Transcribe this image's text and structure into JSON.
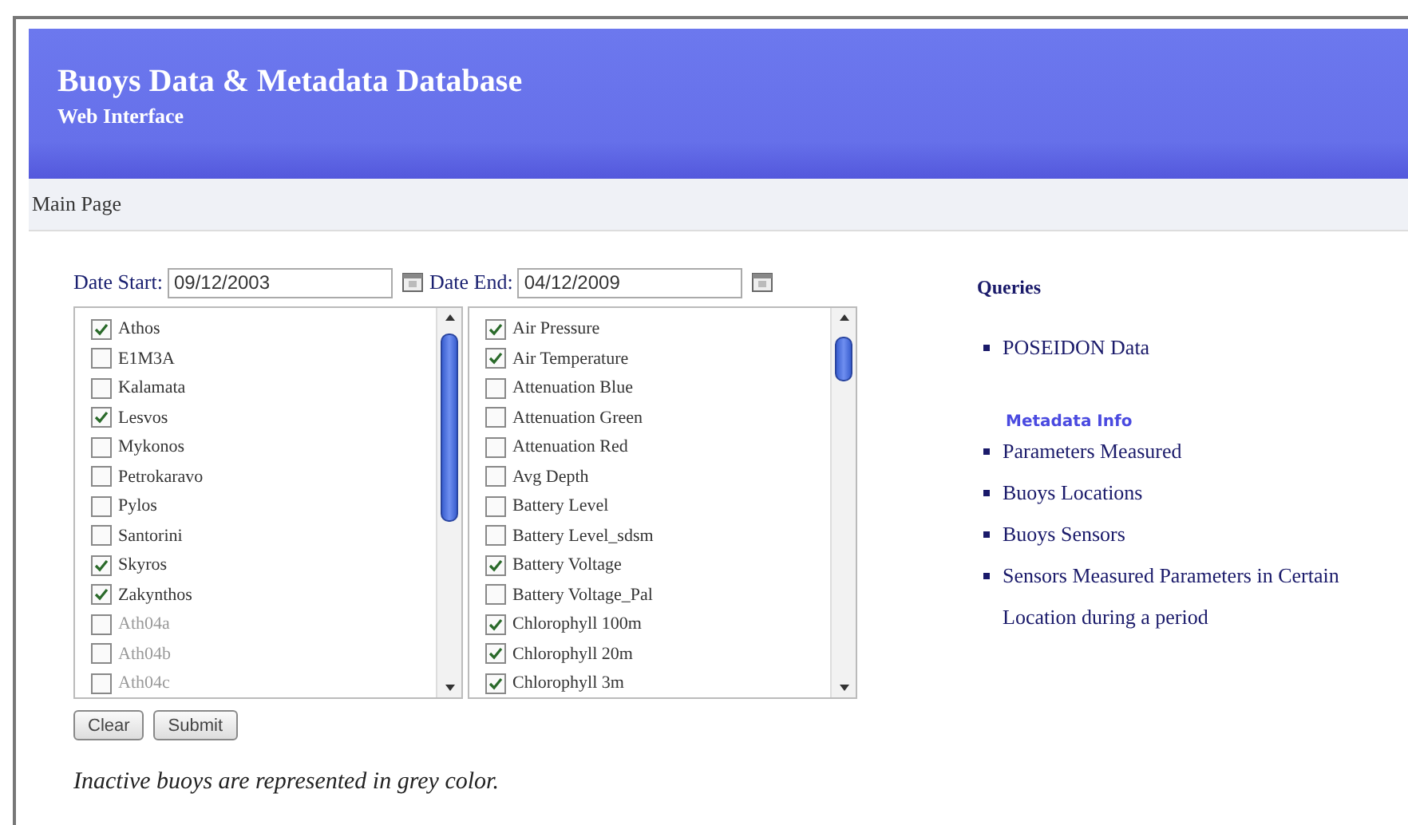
{
  "header": {
    "title": "Buoys Data & Metadata Database",
    "subtitle": "Web Interface"
  },
  "nav": {
    "items": [
      "Main Page"
    ]
  },
  "date_start": {
    "label": "Date Start:",
    "value": "09/12/2003"
  },
  "date_end": {
    "label": "Date End:",
    "value": "04/12/2009"
  },
  "buoys": [
    {
      "label": "Athos",
      "checked": true,
      "inactive": false
    },
    {
      "label": "E1M3A",
      "checked": false,
      "inactive": false
    },
    {
      "label": "Kalamata",
      "checked": false,
      "inactive": false
    },
    {
      "label": "Lesvos",
      "checked": true,
      "inactive": false
    },
    {
      "label": "Mykonos",
      "checked": false,
      "inactive": false
    },
    {
      "label": "Petrokaravo",
      "checked": false,
      "inactive": false
    },
    {
      "label": "Pylos",
      "checked": false,
      "inactive": false
    },
    {
      "label": "Santorini",
      "checked": false,
      "inactive": false
    },
    {
      "label": "Skyros",
      "checked": true,
      "inactive": false
    },
    {
      "label": "Zakynthos",
      "checked": true,
      "inactive": false
    },
    {
      "label": "Ath04a",
      "checked": false,
      "inactive": true
    },
    {
      "label": "Ath04b",
      "checked": false,
      "inactive": true
    },
    {
      "label": "Ath04c",
      "checked": false,
      "inactive": true
    }
  ],
  "parameters": [
    {
      "label": "Air Pressure",
      "checked": true
    },
    {
      "label": "Air Temperature",
      "checked": true
    },
    {
      "label": "Attenuation Blue",
      "checked": false
    },
    {
      "label": "Attenuation Green",
      "checked": false
    },
    {
      "label": "Attenuation Red",
      "checked": false
    },
    {
      "label": "Avg Depth",
      "checked": false
    },
    {
      "label": "Battery Level",
      "checked": false
    },
    {
      "label": "Battery Level_sdsm",
      "checked": false
    },
    {
      "label": "Battery Voltage",
      "checked": true
    },
    {
      "label": "Battery Voltage_Pal",
      "checked": false
    },
    {
      "label": "Chlorophyll 100m",
      "checked": true
    },
    {
      "label": "Chlorophyll 20m",
      "checked": true
    },
    {
      "label": "Chlorophyll 3m",
      "checked": true
    }
  ],
  "buttons": [
    "Clear",
    "Submit"
  ],
  "note": "Inactive buoys are represented in grey color.",
  "queries": {
    "title": "Queries",
    "links": [
      "POSEIDON Data"
    ]
  },
  "metadata": {
    "title": "Metadata Info",
    "links": [
      "Parameters Measured",
      "Buoys Locations",
      "Buoys Sensors",
      "Sensors Measured Parameters in Certain Location during a period"
    ]
  }
}
